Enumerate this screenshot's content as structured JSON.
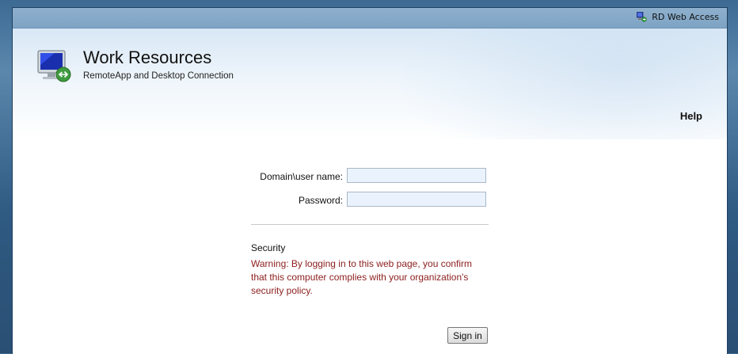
{
  "topbar": {
    "app_label": "RD Web Access",
    "icon": "rd-web-access-icon"
  },
  "header": {
    "title": "Work Resources",
    "subtitle": "RemoteApp and Desktop Connection",
    "help_link": "Help",
    "icon": "remote-desktop-icon"
  },
  "login": {
    "username_label": "Domain\\user name:",
    "username_value": "",
    "password_label": "Password:",
    "password_value": "",
    "security_title": "Security",
    "security_warning": "Warning: By logging in to this web page, you confirm that this computer complies with your organization's security policy.",
    "signin_label": "Sign in"
  },
  "colors": {
    "accent_orange": "#f39a1e",
    "warning_text": "#8b1d1d",
    "topbar": "#7ea3c3"
  }
}
